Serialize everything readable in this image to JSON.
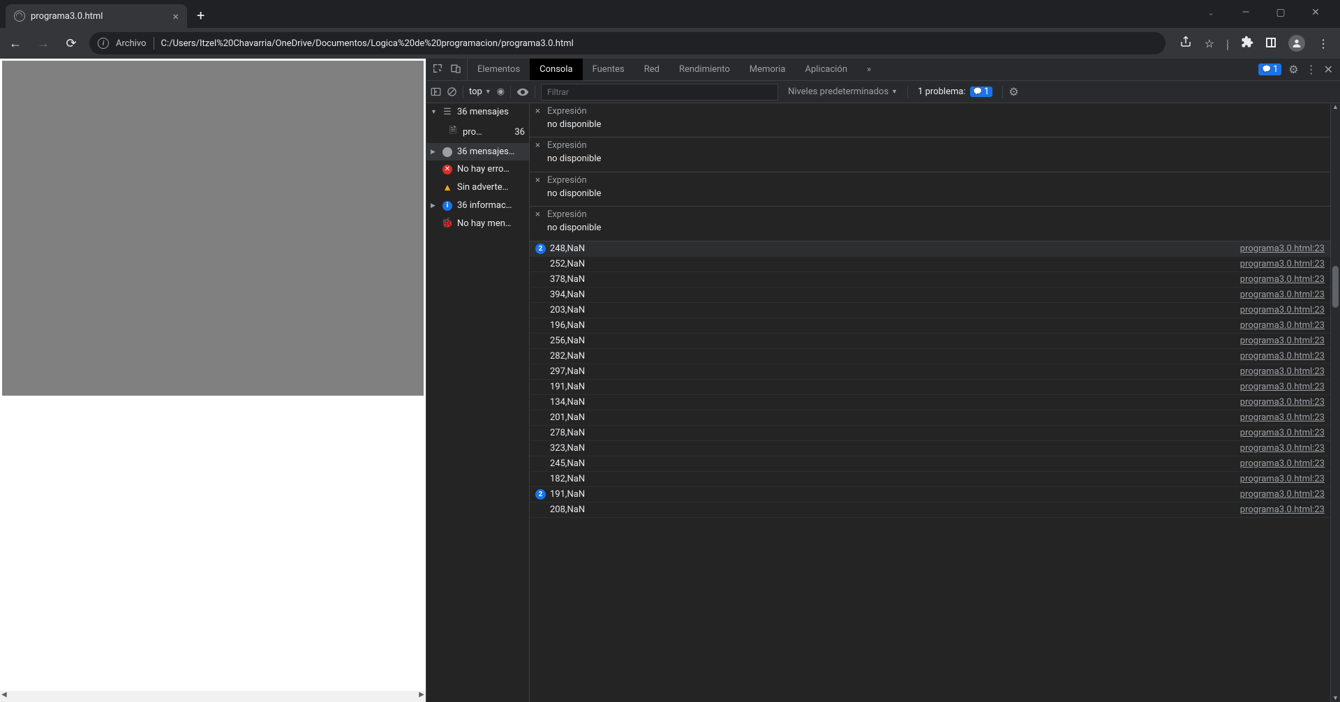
{
  "browser": {
    "tab_title": "programa3.0.html",
    "url_label": "Archivo",
    "url": "C:/Users/Itzel%20Chavarria/OneDrive/Documentos/Logica%20de%20programacion/programa3.0.html"
  },
  "devtools": {
    "tabs": [
      "Elementos",
      "Consola",
      "Fuentes",
      "Red",
      "Rendimiento",
      "Memoria",
      "Aplicación"
    ],
    "active_tab": "Consola",
    "more": "»",
    "issues_count": "1",
    "subbar": {
      "context": "top",
      "filter_placeholder": "Filtrar",
      "levels": "Niveles predeterminados",
      "problems_label": "1 problema:",
      "problems_count": "1"
    },
    "sidebar": [
      {
        "kind": "group",
        "tri": "▼",
        "icon": "list",
        "label": "36 mensajes"
      },
      {
        "kind": "sub",
        "icon": "file",
        "label": "pro…",
        "count": "36"
      },
      {
        "kind": "group",
        "tri": "▶",
        "icon": "user",
        "label": "36 mensajes…",
        "selected": true
      },
      {
        "kind": "item",
        "icon": "err",
        "label": "No hay erro…"
      },
      {
        "kind": "item",
        "icon": "warn",
        "label": "Sin adverte…"
      },
      {
        "kind": "group",
        "tri": "▶",
        "icon": "info",
        "label": "36 informac…"
      },
      {
        "kind": "item",
        "icon": "bug",
        "label": "No hay men…"
      }
    ],
    "expressions": [
      {
        "label": "Expresión",
        "value": "no disponible"
      },
      {
        "label": "Expresión",
        "value": "no disponible"
      },
      {
        "label": "Expresión",
        "value": "no disponible"
      },
      {
        "label": "Expresión",
        "value": "no disponible"
      }
    ],
    "logs": [
      {
        "badge": "2",
        "msg": "248,NaN",
        "src": "programa3.0.html:23",
        "hl": true
      },
      {
        "msg": "252,NaN",
        "src": "programa3.0.html:23"
      },
      {
        "msg": "378,NaN",
        "src": "programa3.0.html:23"
      },
      {
        "msg": "394,NaN",
        "src": "programa3.0.html:23"
      },
      {
        "msg": "203,NaN",
        "src": "programa3.0.html:23"
      },
      {
        "msg": "196,NaN",
        "src": "programa3.0.html:23"
      },
      {
        "msg": "256,NaN",
        "src": "programa3.0.html:23"
      },
      {
        "msg": "282,NaN",
        "src": "programa3.0.html:23"
      },
      {
        "msg": "297,NaN",
        "src": "programa3.0.html:23"
      },
      {
        "msg": "191,NaN",
        "src": "programa3.0.html:23"
      },
      {
        "msg": "134,NaN",
        "src": "programa3.0.html:23"
      },
      {
        "msg": "201,NaN",
        "src": "programa3.0.html:23"
      },
      {
        "msg": "278,NaN",
        "src": "programa3.0.html:23"
      },
      {
        "msg": "323,NaN",
        "src": "programa3.0.html:23"
      },
      {
        "msg": "245,NaN",
        "src": "programa3.0.html:23"
      },
      {
        "msg": "182,NaN",
        "src": "programa3.0.html:23"
      },
      {
        "badge": "2",
        "msg": "191,NaN",
        "src": "programa3.0.html:23"
      },
      {
        "msg": "208,NaN",
        "src": "programa3.0.html:23"
      }
    ]
  }
}
